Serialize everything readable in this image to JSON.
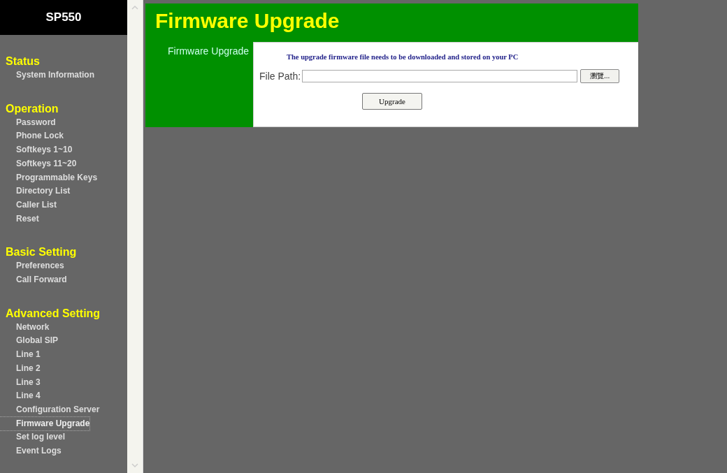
{
  "logo": "SP550",
  "sidebar": {
    "sections": [
      {
        "title": "Status",
        "items": [
          {
            "label": "System Information",
            "selected": false
          }
        ]
      },
      {
        "title": "Operation",
        "items": [
          {
            "label": "Password",
            "selected": false
          },
          {
            "label": "Phone Lock",
            "selected": false
          },
          {
            "label": "Softkeys 1~10",
            "selected": false
          },
          {
            "label": "Softkeys 11~20",
            "selected": false
          },
          {
            "label": "Programmable Keys",
            "selected": false
          },
          {
            "label": "Directory List",
            "selected": false
          },
          {
            "label": "Caller List",
            "selected": false
          },
          {
            "label": "Reset",
            "selected": false
          }
        ]
      },
      {
        "title": "Basic Setting",
        "items": [
          {
            "label": "Preferences",
            "selected": false
          },
          {
            "label": "Call Forward",
            "selected": false
          }
        ]
      },
      {
        "title": "Advanced Setting",
        "items": [
          {
            "label": "Network",
            "selected": false
          },
          {
            "label": "Global SIP",
            "selected": false
          },
          {
            "label": "Line 1",
            "selected": false
          },
          {
            "label": "Line 2",
            "selected": false
          },
          {
            "label": "Line 3",
            "selected": false
          },
          {
            "label": "Line 4",
            "selected": false
          },
          {
            "label": "Configuration Server",
            "selected": false
          },
          {
            "label": "Firmware Upgrade",
            "selected": true
          },
          {
            "label": "Set log level",
            "selected": false
          },
          {
            "label": "Event Logs",
            "selected": false
          }
        ]
      }
    ]
  },
  "page": {
    "title": "Firmware Upgrade",
    "section_label": "Firmware Upgrade",
    "note": "The upgrade firmware file needs to be downloaded and stored on your PC",
    "file_path_label": "File Path:",
    "browse_button": "瀏覽...",
    "upgrade_button": "Upgrade"
  }
}
